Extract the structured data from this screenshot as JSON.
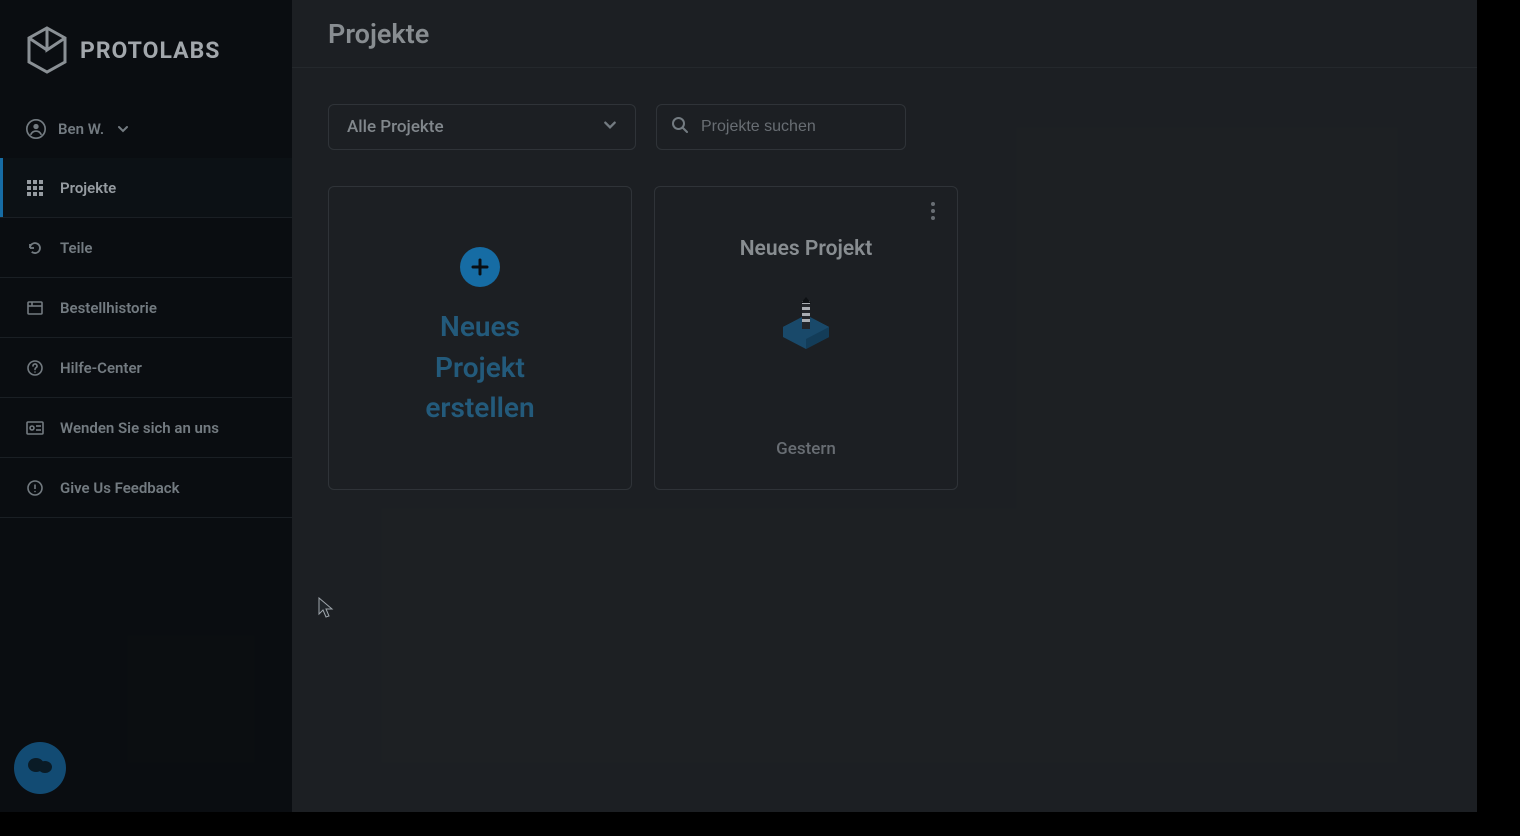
{
  "brand": {
    "name": "PROTOLABS"
  },
  "user": {
    "display_name": "Ben W."
  },
  "sidebar": {
    "items": [
      {
        "label": "Projekte",
        "icon": "grid-icon",
        "active": true
      },
      {
        "label": "Teile",
        "icon": "undo-icon",
        "active": false
      },
      {
        "label": "Bestellhistorie",
        "icon": "history-icon",
        "active": false
      },
      {
        "label": "Hilfe-Center",
        "icon": "help-icon",
        "active": false
      },
      {
        "label": "Wenden Sie sich an uns",
        "icon": "contact-icon",
        "active": false
      },
      {
        "label": "Give Us Feedback",
        "icon": "feedback-icon",
        "active": false
      }
    ]
  },
  "header": {
    "title": "Projekte"
  },
  "toolbar": {
    "filter_selected": "Alle Projekte",
    "search_placeholder": "Projekte suchen"
  },
  "cards": {
    "create_label": "Neues Projekt erstellen",
    "projects": [
      {
        "name": "Neues Projekt",
        "timestamp": "Gestern"
      }
    ]
  }
}
